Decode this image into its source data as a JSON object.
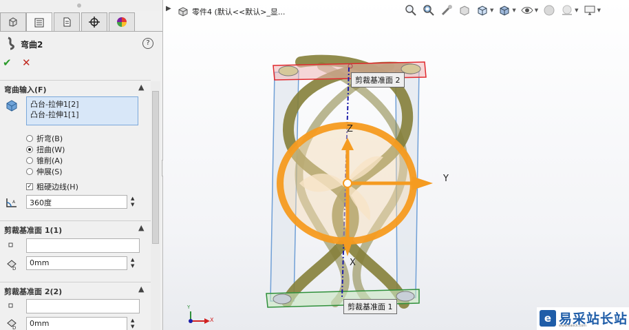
{
  "property_manager": {
    "feature_title": "弯曲2",
    "help_label": "?",
    "ok_label": "✔",
    "cancel_label": "✕",
    "bend_input": {
      "title": "弯曲输入(F)",
      "bodies": [
        "凸台-拉伸1[2]",
        "凸台-拉伸1[1]"
      ],
      "options": [
        {
          "label": "折弯(B)",
          "selected": false
        },
        {
          "label": "扭曲(W)",
          "selected": true
        },
        {
          "label": "锥削(A)",
          "selected": false
        },
        {
          "label": "伸展(S)",
          "selected": false
        }
      ],
      "hard_edges_label": "粗硬边线(H)",
      "hard_edges_checked": true,
      "angle_value": "360度"
    },
    "trim_plane_1": {
      "title": "剪裁基准面 1(1)",
      "entity": "",
      "distance": "0mm"
    },
    "trim_plane_2": {
      "title": "剪裁基准面 2(2)",
      "entity": "",
      "distance": "0mm"
    }
  },
  "viewport": {
    "tree_title": "零件4  (默认<<默认>_显...",
    "plane_label_1": "剪裁基准面 1",
    "plane_label_2": "剪裁基准面 2",
    "axis_y": "Y",
    "axis_z": "Z",
    "axis_x": "X",
    "triad_y": "Y",
    "triad_x": "X"
  },
  "watermark": {
    "logo": "e",
    "text": "易采站长站",
    "sub": "www.easck.com"
  },
  "colors": {
    "accent_orange": "#f59b20",
    "model_olive": "#85803a",
    "plane_red": "#e0282d",
    "plane_green": "#2e8f3a",
    "selection_blue": "#d8e7f8"
  }
}
